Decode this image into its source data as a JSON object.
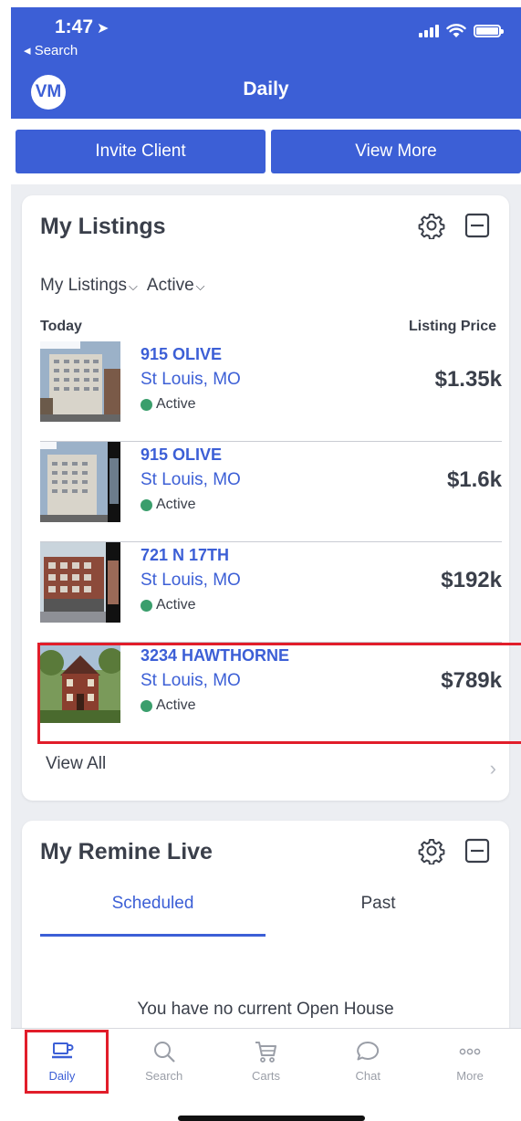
{
  "status_bar": {
    "time": "1:47",
    "back_label": "Search"
  },
  "header": {
    "avatar_initials": "VM",
    "title": "Daily"
  },
  "actions": {
    "invite_client": "Invite Client",
    "view_more": "View More"
  },
  "my_listings": {
    "title": "My Listings",
    "filter_1": "My Listings",
    "filter_2": "Active",
    "col_left": "Today",
    "col_right": "Listing Price",
    "items": [
      {
        "address": "915 OLIVE",
        "city": "St Louis, MO",
        "status": "Active",
        "price": "$1.35k"
      },
      {
        "address": "915 OLIVE",
        "city": "St Louis, MO",
        "status": "Active",
        "price": "$1.6k"
      },
      {
        "address": "721 N 17TH",
        "city": "St Louis, MO",
        "status": "Active",
        "price": "$192k"
      },
      {
        "address": "3234 HAWTHORNE",
        "city": "St Louis, MO",
        "status": "Active",
        "price": "$789k"
      }
    ],
    "view_all": "View All"
  },
  "remine_live": {
    "title": "My Remine Live",
    "tab_scheduled": "Scheduled",
    "tab_past": "Past",
    "empty_message": "You have no current Open House"
  },
  "bottom_nav": {
    "daily": "Daily",
    "search": "Search",
    "carts": "Carts",
    "chat": "Chat",
    "more": "More"
  },
  "colors": {
    "brand_blue": "#3c5fd6",
    "highlight_red": "#e11d2a",
    "active_green": "#3a9e6c"
  }
}
